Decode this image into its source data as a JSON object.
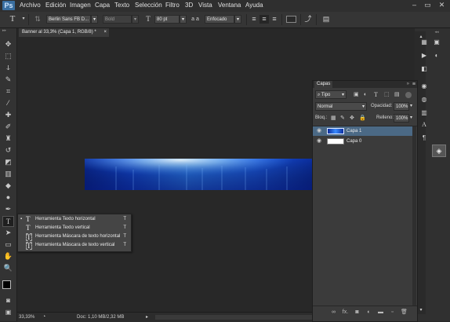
{
  "app": {
    "logo": "Ps"
  },
  "menubar": {
    "items": [
      "Archivo",
      "Edición",
      "Imagen",
      "Capa",
      "Texto",
      "Selección",
      "Filtro",
      "3D",
      "Vista",
      "Ventana",
      "Ayuda"
    ],
    "window_controls": [
      "–",
      "▭",
      "✕"
    ]
  },
  "options": {
    "tool_glyph": "T",
    "font_family": "Berlin Sans FB D...",
    "font_style": "Bold",
    "size_glyph": "T",
    "font_size": "80 pt",
    "antialias_glyph": "a a",
    "antialias": "Enfocado",
    "text_color": "#2a2a2a"
  },
  "document": {
    "tab_title": "Banner al 33,3% (Capa 1, RGB/8) *",
    "tab_close": "×"
  },
  "flyout": {
    "items": [
      {
        "bullet": "▪",
        "glyph": "T",
        "label": "Herramienta Texto horizontal",
        "key": "T"
      },
      {
        "bullet": "",
        "glyph": "T",
        "label": "Herramienta Texto vertical",
        "key": "T"
      },
      {
        "bullet": "",
        "glyph": "T",
        "label": "Herramienta Máscara de texto horizontal",
        "key": "T"
      },
      {
        "bullet": "",
        "glyph": "T",
        "label": "Herramienta Máscara de texto vertical",
        "key": "T"
      }
    ]
  },
  "status": {
    "zoom": "33,33%",
    "doc": "Doc: 1,10 MB/2,32 MB"
  },
  "layers_panel": {
    "tab": "Capas",
    "filter": "Tipo",
    "blend_mode": "Normal",
    "opacity_label": "Opacidad:",
    "opacity": "100%",
    "lock_label": "Bloq.:",
    "fill_label": "Relleno:",
    "fill": "100%",
    "layers": [
      {
        "name": "Capa 1",
        "selected": true
      },
      {
        "name": "Capa 0",
        "selected": false
      }
    ],
    "bottom_buttons": [
      "link-icon",
      "fx-icon",
      "mask-icon",
      "adjustment-icon",
      "folder-icon",
      "new-layer-icon",
      "trash-icon"
    ],
    "fx_label": "fx."
  },
  "colors": {
    "accent": "#3a6fa0",
    "selection": "#4a6a8a",
    "banner_blue": "#1d5fd8"
  }
}
